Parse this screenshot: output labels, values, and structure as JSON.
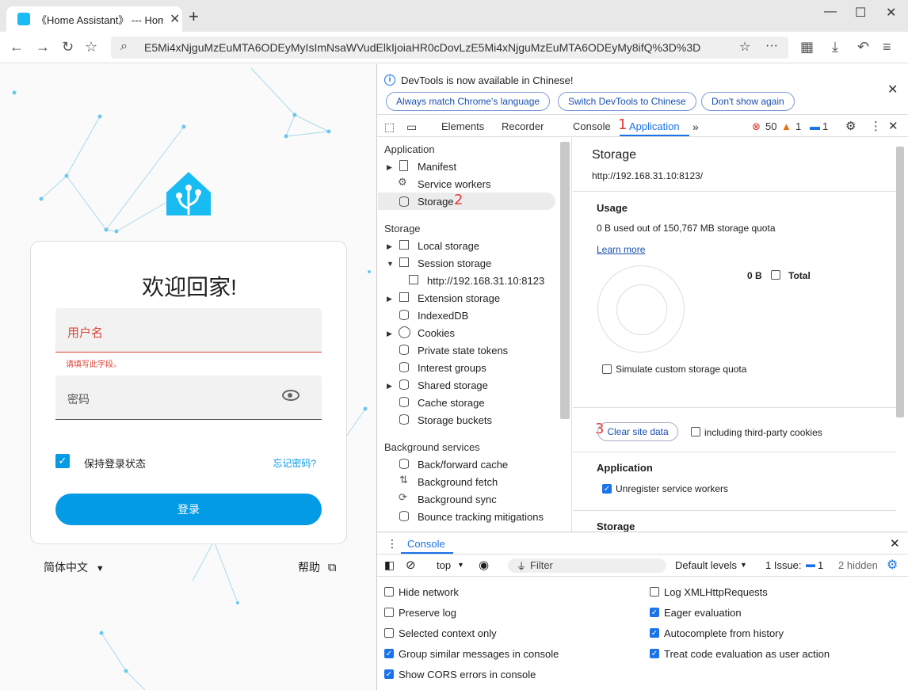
{
  "browser": {
    "tab_title": "《Home Assistant》 --- Hom",
    "address_url": "E5Mi4xNjguMzEuMTA6ODEyMyIsImNsaWVudElkIjoiaHR0cDovLzE5Mi4xNjguMzEuMTA6ODEyMy8ifQ%3D%3D"
  },
  "login": {
    "welcome": "欢迎回家!",
    "username_label": "用户名",
    "username_error": "请填写此字段。",
    "password_label": "密码",
    "stay_logged_in": "保持登录状态",
    "forgot_password": "忘记密码?",
    "login_button": "登录",
    "language": "简体中文",
    "help": "帮助"
  },
  "devtools": {
    "info_message": "DevTools is now available in Chinese!",
    "info_buttons": [
      "Always match Chrome's language",
      "Switch DevTools to Chinese",
      "Don't show again"
    ],
    "tabs": [
      "Elements",
      "Recorder",
      "Console",
      "Application"
    ],
    "active_tab": "Application",
    "error_count": "50",
    "warning_count": "1",
    "message_count": "1",
    "sidebar": {
      "application_header": "Application",
      "application_items": [
        "Manifest",
        "Service workers",
        "Storage"
      ],
      "storage_header": "Storage",
      "storage_items": [
        "Local storage",
        "Session storage",
        "http://192.168.31.10:8123",
        "Extension storage",
        "IndexedDB",
        "Cookies",
        "Private state tokens",
        "Interest groups",
        "Shared storage",
        "Cache storage",
        "Storage buckets"
      ],
      "background_header": "Background services",
      "background_items": [
        "Back/forward cache",
        "Background fetch",
        "Background sync",
        "Bounce tracking mitigations"
      ]
    },
    "main": {
      "title": "Storage",
      "origin": "http://192.168.31.10:8123/",
      "usage_header": "Usage",
      "usage_text": "0 B used out of 150,767 MB storage quota",
      "learn_more": "Learn more",
      "total_value": "0 B",
      "total_label": "Total",
      "simulate_quota": "Simulate custom storage quota",
      "clear_site_data": "Clear site data",
      "third_party_cookies": "including third-party cookies",
      "application_header": "Application",
      "unregister_sw": "Unregister service workers",
      "storage_header": "Storage"
    },
    "annotations": [
      "1",
      "2",
      "3"
    ],
    "console": {
      "tab_label": "Console",
      "context": "top",
      "filter_placeholder": "Filter",
      "levels": "Default levels",
      "issues_label": "1 Issue:",
      "issues_count": "1",
      "hidden": "2 hidden",
      "settings_left": [
        {
          "label": "Hide network",
          "checked": false
        },
        {
          "label": "Preserve log",
          "checked": false
        },
        {
          "label": "Selected context only",
          "checked": false
        },
        {
          "label": "Group similar messages in console",
          "checked": true
        },
        {
          "label": "Show CORS errors in console",
          "checked": true
        }
      ],
      "settings_right": [
        {
          "label": "Log XMLHttpRequests",
          "checked": false
        },
        {
          "label": "Eager evaluation",
          "checked": true
        },
        {
          "label": "Autocomplete from history",
          "checked": true
        },
        {
          "label": "Treat code evaluation as user action",
          "checked": true
        }
      ]
    }
  },
  "colors": {
    "ha_blue": "#039be5",
    "devtools_blue": "#1a73e8",
    "error_red": "#db4437",
    "annotation_red": "#e53935"
  }
}
